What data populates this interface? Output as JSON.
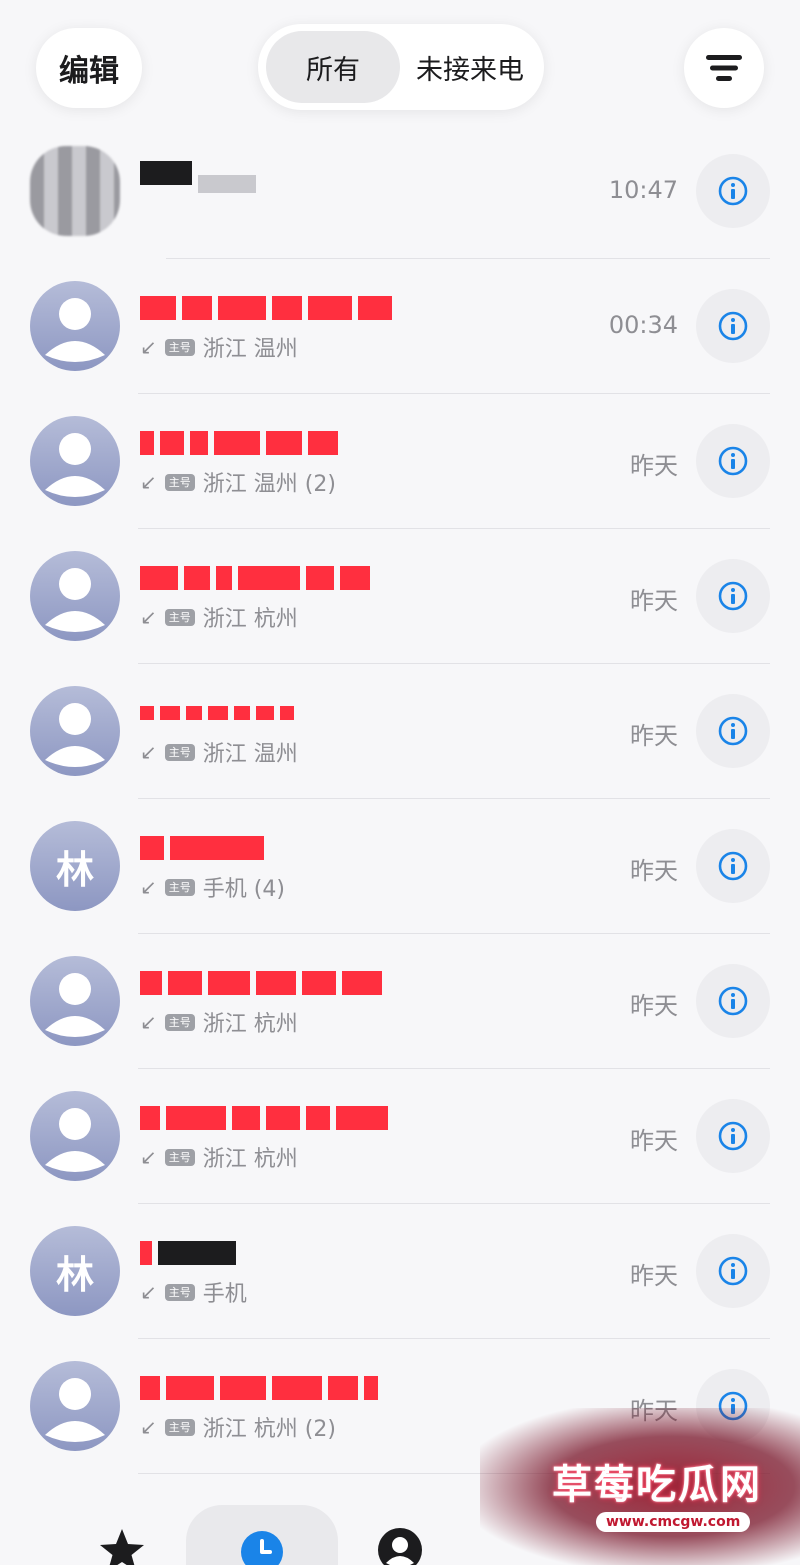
{
  "header": {
    "edit_label": "编辑",
    "segments": [
      "所有",
      "未接来电"
    ],
    "active_segment": "所有"
  },
  "sim_badge": "主号",
  "calls": [
    {
      "avatar": "blur",
      "location": "",
      "time": "10:47"
    },
    {
      "avatar": "person",
      "location": "浙江 温州",
      "time": "00:34"
    },
    {
      "avatar": "person",
      "location": "浙江 温州 (2)",
      "time": "昨天"
    },
    {
      "avatar": "person",
      "location": "浙江 杭州",
      "time": "昨天"
    },
    {
      "avatar": "person",
      "location": "浙江 温州",
      "time": "昨天"
    },
    {
      "avatar": "letter",
      "letter": "林",
      "location": "手机 (4)",
      "time": "昨天"
    },
    {
      "avatar": "person",
      "location": "浙江 杭州",
      "time": "昨天"
    },
    {
      "avatar": "person",
      "location": "浙江 杭州",
      "time": "昨天"
    },
    {
      "avatar": "letter",
      "letter": "林",
      "location": "手机",
      "time": "昨天"
    },
    {
      "avatar": "person",
      "location": "浙江 杭州 (2)",
      "time": "昨天"
    }
  ],
  "tabs": [
    "favorites-star-icon",
    "recents-clock-icon",
    "contacts-person-icon"
  ],
  "active_tab": "recents-clock-icon",
  "colors": {
    "accent": "#1a84e8",
    "redacted": "#ff2f3f",
    "avatar": "#9aa2cc"
  },
  "watermark": {
    "title": "草莓吃瓜网",
    "url": "www.cmcgw.com"
  }
}
